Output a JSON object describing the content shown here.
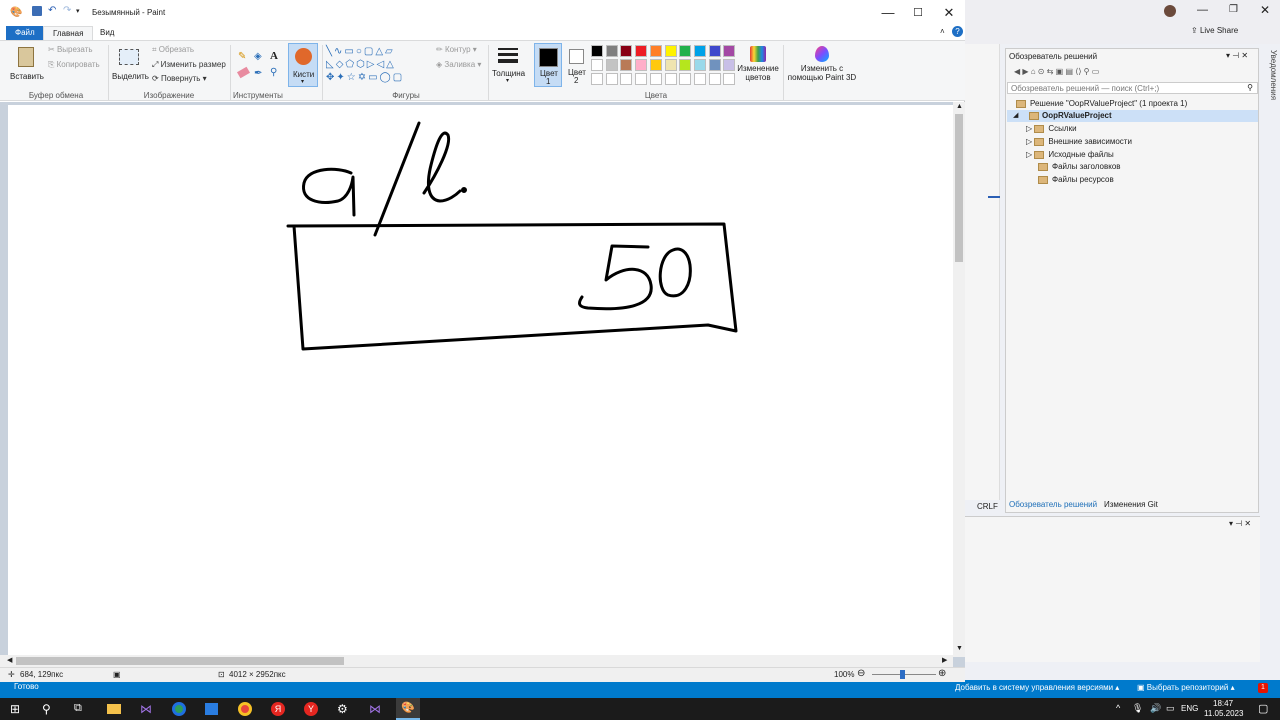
{
  "paint": {
    "title": "Безымянный - Paint",
    "tabs": [
      "Файл",
      "Главная",
      "Вид"
    ],
    "clipboard": {
      "paste": "Вставить",
      "cut": "Вырезать",
      "copy": "Копировать",
      "group": "Буфер обмена"
    },
    "image": {
      "select": "Выделить",
      "crop": "Обрезать",
      "resize": "Изменить размер",
      "rotate": "Повернуть",
      "group": "Изображение"
    },
    "tools": {
      "group": "Инструменты"
    },
    "brushes": {
      "label": "Кисти"
    },
    "shapes": {
      "outline": "Контур",
      "fill": "Заливка",
      "group": "Фигуры"
    },
    "size": {
      "label": "Толщина"
    },
    "color1": {
      "label": "Цвет",
      "num": "1"
    },
    "color2": {
      "label": "Цвет",
      "num": "2"
    },
    "colors_group": "Цвета",
    "edit_colors": {
      "line1": "Изменение",
      "line2": "цветов"
    },
    "paint3d": {
      "line1": "Изменить с",
      "line2": "помощью Paint 3D"
    },
    "palette_row1": [
      "#000000",
      "#7f7f7f",
      "#880015",
      "#ed1c24",
      "#ff7f27",
      "#fff200",
      "#22b14c",
      "#00a2e8",
      "#3f48cc",
      "#a349a4"
    ],
    "palette_row2": [
      "#ffffff",
      "#c3c3c3",
      "#b97a57",
      "#ffaec9",
      "#ffc90e",
      "#efe4b0",
      "#b5e61d",
      "#99d9ea",
      "#7092be",
      "#c8bfe7"
    ],
    "status": {
      "cursor": "684, 129пкс",
      "dimensions": "4012 × 2952пкс",
      "zoom": "100%"
    }
  },
  "vs": {
    "live_share": "Live Share",
    "solution_explorer": {
      "title": "Обозреватель решений",
      "search_placeholder": "Обозреватель решений — поиск (Ctrl+;)",
      "solution": "Решение \"OopRValueProject\" (1 проекта 1)",
      "project": "OopRValueProject",
      "items": [
        "Ссылки",
        "Внешние зависимости",
        "Исходные файлы",
        "Файлы заголовков",
        "Файлы ресурсов"
      ]
    },
    "tabs": [
      "Обозреватель решений",
      "Изменения Git"
    ],
    "crlf": "CRLF",
    "notifications": "Уведомления",
    "status_left": "Готово",
    "add_vcs": "Добавить в систему управления версиями",
    "select_repo": "Выбрать репозиторий",
    "badge": "1"
  },
  "taskbar": {
    "lang": "ENG",
    "time": "18:47",
    "date": "11.05.2023"
  },
  "drawing": {
    "colors": {
      "ink": "#000000"
    }
  }
}
